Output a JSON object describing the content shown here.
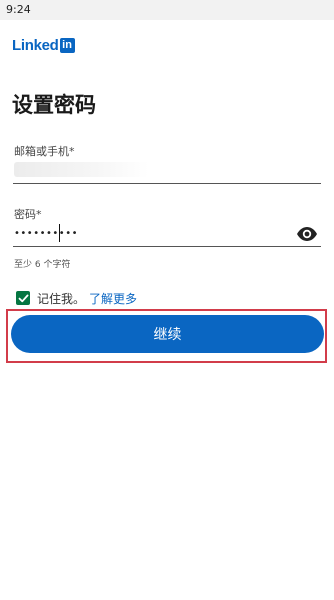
{
  "status_bar": {
    "time": "9:24"
  },
  "logo": {
    "word": "Linked",
    "box": "in"
  },
  "page": {
    "title": "设置密码"
  },
  "email": {
    "label": "邮箱或手机*"
  },
  "password": {
    "label": "密码*",
    "value": "••••••••••",
    "hint": "至少 6 个字符",
    "toggle_icon": "eye-icon"
  },
  "remember": {
    "checked": true,
    "label": "记住我。",
    "learn_more": "了解更多"
  },
  "continue": {
    "label": "继续"
  },
  "colors": {
    "brand": "#0a66c2",
    "checkbox": "#057642",
    "highlight": "#d23c4a"
  }
}
